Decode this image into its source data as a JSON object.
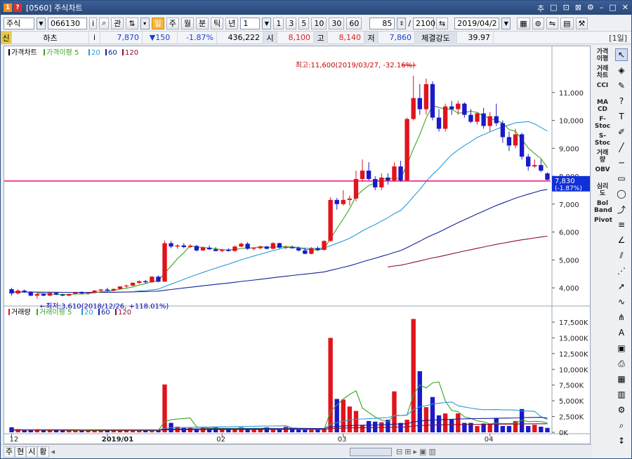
{
  "window": {
    "num_badge": "1",
    "q_badge": "?",
    "title": "[0560] 주식차트",
    "controls": [
      "추",
      "□",
      "⊡",
      "⊠",
      "⚙",
      "–",
      "□",
      "✕"
    ]
  },
  "toolbar": {
    "market": "주식",
    "code": "066130",
    "info": "i",
    "search_glyph": "⌕",
    "gwan": "관",
    "period_buttons": [
      "일",
      "주",
      "월",
      "분",
      "틱",
      "년"
    ],
    "active_period": "일",
    "interval_value": "1",
    "quick_buttons": [
      "1",
      "3",
      "5",
      "10",
      "30",
      "60"
    ],
    "count": "85",
    "slash": "/",
    "total": "2100",
    "date": "2019/04/2"
  },
  "infobar": {
    "credit": "신",
    "name": "하츠",
    "info": "i",
    "price": "7,870",
    "change": "▼150",
    "change_pct": "-1.87%",
    "volume": "436,222",
    "open_label": "시",
    "open": "8,100",
    "high_label": "고",
    "high": "8,140",
    "low_label": "저",
    "low": "7,860",
    "strength_label": "체결강도",
    "strength": "39.97",
    "period_label": "[1일]"
  },
  "price_panel": {
    "legend": [
      "가격차트",
      "가격이평 5",
      "20",
      "60",
      "120"
    ],
    "high_note": "최고:11,600(2019/03/27, -32.16%)",
    "low_note": "←최저:3,610(2018/12/26, +118.01%)",
    "y_ticks": [
      "11,000",
      "10,000",
      "9,000",
      "8,000",
      "7,000",
      "6,000",
      "5,000",
      "4,000"
    ],
    "current_price": "7,830",
    "current_pct": "(-1.87%)"
  },
  "volume_panel": {
    "legend": [
      "거래량",
      "거래이평 5",
      "20",
      "60",
      "120"
    ],
    "y_ticks": [
      "17,500K",
      "15,000K",
      "12,500K",
      "10,000K",
      "7,500K",
      "5,000K",
      "2,500K",
      "0K"
    ]
  },
  "x_axis": {
    "labels": [
      "12",
      "2019/01",
      "02",
      "03",
      "04"
    ]
  },
  "colors": {
    "up": "#e0141c",
    "down": "#1a1ac8",
    "ma5": "#3aa51e",
    "ma20": "#2a9ad8",
    "ma60": "#10229a",
    "ma120": "#8a1030",
    "hline": "#e0137c"
  },
  "bottom_tabs": [
    "주",
    "현",
    "시",
    "황"
  ],
  "rightbar": {
    "labels": [
      "가격\n이평",
      "거래\n차트",
      "CCI",
      "MA\nCD",
      "F-\nStoc",
      "S-\nStoc",
      "거래\n량",
      "OBV",
      "심리\n도",
      "Bol\nBand",
      "Pivot"
    ],
    "icons": [
      "cursor-icon",
      "eraser-icon",
      "paint-icon",
      "help-icon",
      "text-icon",
      "pen-icon",
      "line-icon",
      "hline-icon",
      "rect-icon",
      "ellipse-icon",
      "trend-icon",
      "fib-icon",
      "gann-icon",
      "channel-icon",
      "fan-icon",
      "arrow-icon",
      "wave-icon",
      "andrew-icon",
      "auto-icon",
      "save-icon",
      "print-icon",
      "grid-icon",
      "layout-icon",
      "config-icon",
      "zoom-icon",
      "scroll-icon"
    ]
  },
  "chart_data": {
    "type": "candlestick",
    "note": "daily candles, 85 bars",
    "candles": [
      [
        3950,
        4000,
        3720,
        3800
      ],
      [
        3800,
        3950,
        3760,
        3900
      ],
      [
        3900,
        3940,
        3820,
        3860
      ],
      [
        3860,
        3880,
        3700,
        3720
      ],
      [
        3720,
        3820,
        3610,
        3780
      ],
      [
        3780,
        3800,
        3700,
        3720
      ],
      [
        3720,
        3840,
        3700,
        3820
      ],
      [
        3820,
        3830,
        3740,
        3760
      ],
      [
        3760,
        3800,
        3700,
        3720
      ],
      [
        3720,
        3800,
        3700,
        3780
      ],
      [
        3780,
        3860,
        3760,
        3840
      ],
      [
        3840,
        3880,
        3780,
        3800
      ],
      [
        3800,
        3850,
        3760,
        3820
      ],
      [
        3820,
        3920,
        3800,
        3900
      ],
      [
        3900,
        3960,
        3860,
        3940
      ],
      [
        3940,
        4000,
        3880,
        3900
      ],
      [
        3900,
        3980,
        3880,
        3960
      ],
      [
        3960,
        4060,
        3940,
        4050
      ],
      [
        4050,
        4120,
        4000,
        4080
      ],
      [
        4080,
        4200,
        4060,
        4180
      ],
      [
        4180,
        4260,
        4140,
        4240
      ],
      [
        4240,
        4280,
        4160,
        4200
      ],
      [
        4200,
        4420,
        4180,
        4400
      ],
      [
        4400,
        4440,
        4200,
        4220
      ],
      [
        4220,
        5700,
        4220,
        5600
      ],
      [
        5600,
        5680,
        5420,
        5480
      ],
      [
        5480,
        5560,
        5400,
        5520
      ],
      [
        5520,
        5600,
        5420,
        5460
      ],
      [
        5460,
        5560,
        5420,
        5500
      ],
      [
        5500,
        5540,
        5300,
        5340
      ],
      [
        5340,
        5480,
        5320,
        5440
      ],
      [
        5440,
        5520,
        5360,
        5380
      ],
      [
        5380,
        5460,
        5300,
        5320
      ],
      [
        5320,
        5400,
        5280,
        5360
      ],
      [
        5360,
        5420,
        5300,
        5320
      ],
      [
        5320,
        5520,
        5300,
        5480
      ],
      [
        5480,
        5620,
        5460,
        5580
      ],
      [
        5580,
        5640,
        5360,
        5400
      ],
      [
        5400,
        5460,
        5340,
        5420
      ],
      [
        5420,
        5520,
        5380,
        5480
      ],
      [
        5480,
        5500,
        5380,
        5400
      ],
      [
        5400,
        5640,
        5380,
        5600
      ],
      [
        5600,
        5620,
        5400,
        5440
      ],
      [
        5440,
        5520,
        5380,
        5460
      ],
      [
        5460,
        5520,
        5400,
        5420
      ],
      [
        5420,
        5480,
        5300,
        5340
      ],
      [
        5340,
        5440,
        5200,
        5220
      ],
      [
        5220,
        5460,
        5200,
        5420
      ],
      [
        5420,
        5480,
        5320,
        5360
      ],
      [
        5360,
        5700,
        5340,
        5680
      ],
      [
        5680,
        7250,
        5650,
        7150
      ],
      [
        7150,
        7220,
        6800,
        7000
      ],
      [
        7000,
        7500,
        6950,
        7150
      ],
      [
        7150,
        7300,
        6950,
        7200
      ],
      [
        7200,
        8200,
        7100,
        7900
      ],
      [
        7900,
        8600,
        7800,
        8200
      ],
      [
        8200,
        8500,
        7850,
        7900
      ],
      [
        7900,
        8000,
        7500,
        7600
      ],
      [
        7600,
        8100,
        7500,
        7950
      ],
      [
        7950,
        8100,
        7700,
        7850
      ],
      [
        7850,
        8500,
        7800,
        8350
      ],
      [
        8350,
        8550,
        7800,
        7850
      ],
      [
        7850,
        10100,
        7850,
        10050
      ],
      [
        10050,
        11600,
        10000,
        10800
      ],
      [
        10800,
        11300,
        10200,
        10400
      ],
      [
        10400,
        11500,
        10200,
        11300
      ],
      [
        11300,
        11400,
        10000,
        10100
      ],
      [
        10100,
        10400,
        9600,
        9700
      ],
      [
        9700,
        10600,
        9600,
        10500
      ],
      [
        10500,
        10700,
        10200,
        10400
      ],
      [
        10400,
        10700,
        10200,
        10600
      ],
      [
        10600,
        10650,
        10100,
        10200
      ],
      [
        10200,
        10400,
        9900,
        9950
      ],
      [
        9950,
        10300,
        9850,
        10250
      ],
      [
        10250,
        10450,
        9700,
        9800
      ],
      [
        9800,
        10300,
        9600,
        10150
      ],
      [
        10150,
        10600,
        9800,
        9900
      ],
      [
        9900,
        10000,
        9200,
        9400
      ],
      [
        9400,
        9600,
        8900,
        9100
      ],
      [
        9100,
        9700,
        9000,
        9500
      ],
      [
        9500,
        9550,
        8600,
        8700
      ],
      [
        8700,
        8800,
        8200,
        8350
      ],
      [
        8350,
        8600,
        8300,
        8400
      ],
      [
        8400,
        8600,
        8150,
        8200
      ],
      [
        8100,
        8140,
        7860,
        7870
      ]
    ],
    "volume_k": [
      800,
      500,
      300,
      300,
      400,
      300,
      300,
      350,
      300,
      300,
      300,
      300,
      300,
      250,
      300,
      350,
      300,
      300,
      300,
      300,
      300,
      300,
      250,
      300,
      7600,
      1500,
      900,
      700,
      700,
      600,
      700,
      600,
      800,
      500,
      600,
      600,
      800,
      600,
      600,
      600,
      800,
      400,
      500,
      900,
      700,
      500,
      400,
      400,
      400,
      500,
      15000,
      5300,
      5200,
      4100,
      3400,
      1200,
      1800,
      1700,
      1600,
      2000,
      6500,
      1500,
      2000,
      18000,
      9700,
      4000,
      5600,
      2700,
      3000,
      2100,
      3000,
      1500,
      1500,
      1000,
      1400,
      1300,
      2200,
      1000,
      1000,
      1800,
      3700,
      1000,
      1200,
      900,
      700
    ],
    "ylim_price": [
      3500,
      12000
    ],
    "ylim_volume_k": [
      0,
      18500
    ],
    "current_price_line": 7830
  }
}
